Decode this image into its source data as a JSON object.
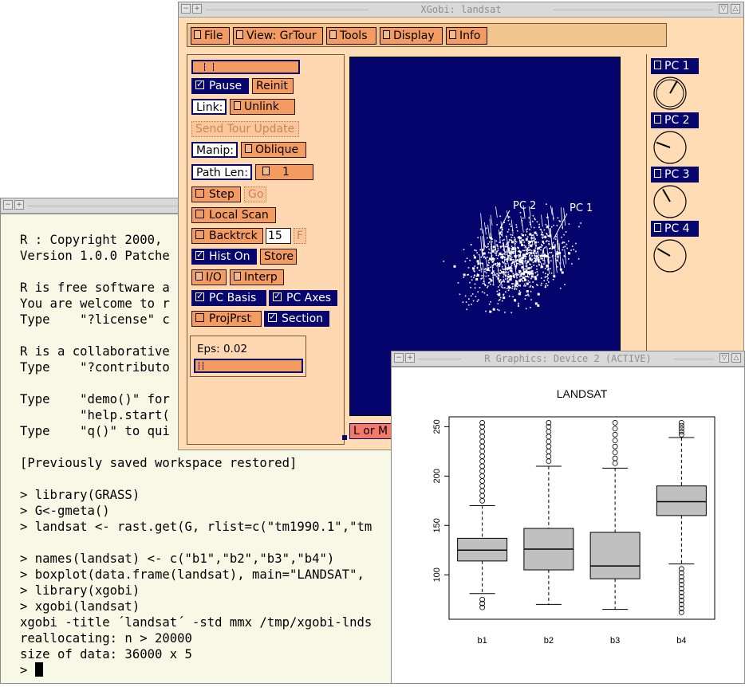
{
  "terminal": {
    "lines": [
      "R : Copyright 2000,",
      "Version 1.0.0 Patche",
      "",
      "R is free software a",
      "You are welcome to r",
      "Type    \"?license\" c",
      "",
      "R is a collaborative",
      "Type    \"?contributo",
      "",
      "Type    \"demo()\" for",
      "        \"help.start(",
      "Type    \"q()\" to qui",
      "",
      "[Previously saved workspace restored]",
      "",
      "> library(GRASS)",
      "> G<-gmeta()",
      "> landsat <- rast.get(G, rlist=c(\"tm1990.1\",\"tm",
      "",
      "> names(landsat) <- c(\"b1\",\"b2\",\"b3\",\"b4\")",
      "> boxplot(data.frame(landsat), main=\"LANDSAT\",",
      "> library(xgobi)",
      "> xgobi(landsat)",
      "xgobi -title ´landsat´ -std mmx /tmp/xgobi-lnds",
      "reallocating: n > 20000",
      "size of data: 36000 x 5"
    ],
    "prompt": "> "
  },
  "xgobi": {
    "title": "XGobi: landsat",
    "menu": [
      "File",
      "View: GrTour",
      "Tools",
      "Display",
      "Info"
    ],
    "controls": {
      "pause": "Pause",
      "reinit": "Reinit",
      "link_label": "Link:",
      "unlink": "Unlink",
      "send_tour_update": "Send Tour Update",
      "manip_label": "Manip:",
      "oblique": "Oblique",
      "path_len_label": "Path Len:",
      "path_len_value": "1",
      "step": "Step",
      "go": "Go",
      "local_scan": "Local Scan",
      "backtrack": "Backtrck",
      "backtrack_value": "15",
      "backtrack_f": "F",
      "hist_on": "Hist On",
      "store": "Store",
      "io": "I/O",
      "interp": "Interp",
      "pc_basis": "PC Basis",
      "pc_axes": "PC Axes",
      "projprst": "ProjPrst",
      "section": "Section",
      "eps": "Eps: 0.02"
    },
    "plot_labels": [
      "PC 2",
      "PC 1"
    ],
    "bottom_button": "L or M",
    "pcs": [
      "PC 1",
      "PC 2",
      "PC 3",
      "PC 4"
    ],
    "colors": {
      "plot_bg": "#04046c",
      "button": "#f49b61",
      "panel": "#ffd8b2",
      "navy": "#06066e"
    }
  },
  "rgraphics": {
    "title": "R Graphics: Device 2 (ACTIVE)"
  },
  "chart_data": {
    "type": "boxplot",
    "title": "LANDSAT",
    "categories": [
      "b1",
      "b2",
      "b3",
      "b4"
    ],
    "ylim": [
      55,
      260
    ],
    "yticks": [
      100,
      150,
      200,
      250
    ],
    "boxes": [
      {
        "name": "b1",
        "low": 81,
        "q1": 114,
        "median": 125,
        "q3": 137,
        "high": 170,
        "outliers_low": [
          75,
          71,
          67
        ],
        "outliers_high": [
          175,
          180,
          185,
          190,
          195,
          200,
          205,
          210,
          215,
          220,
          225,
          230,
          235,
          240,
          245,
          250,
          254
        ]
      },
      {
        "name": "b2",
        "low": 70,
        "q1": 105,
        "median": 126,
        "q3": 147,
        "high": 210,
        "outliers_low": [],
        "outliers_high": [
          215,
          220,
          225,
          230,
          235,
          240,
          245,
          250,
          254
        ]
      },
      {
        "name": "b3",
        "low": 65,
        "q1": 96,
        "median": 109,
        "q3": 143,
        "high": 208,
        "outliers_low": [],
        "outliers_high": [
          213,
          218,
          224,
          230,
          236,
          242,
          248,
          254
        ]
      },
      {
        "name": "b4",
        "low": 111,
        "q1": 160,
        "median": 174,
        "q3": 190,
        "high": 239,
        "outliers_low": [
          106,
          102,
          98,
          94,
          90,
          86,
          82,
          78,
          74,
          70,
          66,
          62
        ],
        "outliers_high": [
          242,
          245,
          248,
          251,
          254
        ]
      }
    ],
    "colors": {
      "box": "#c0c0c0"
    }
  }
}
